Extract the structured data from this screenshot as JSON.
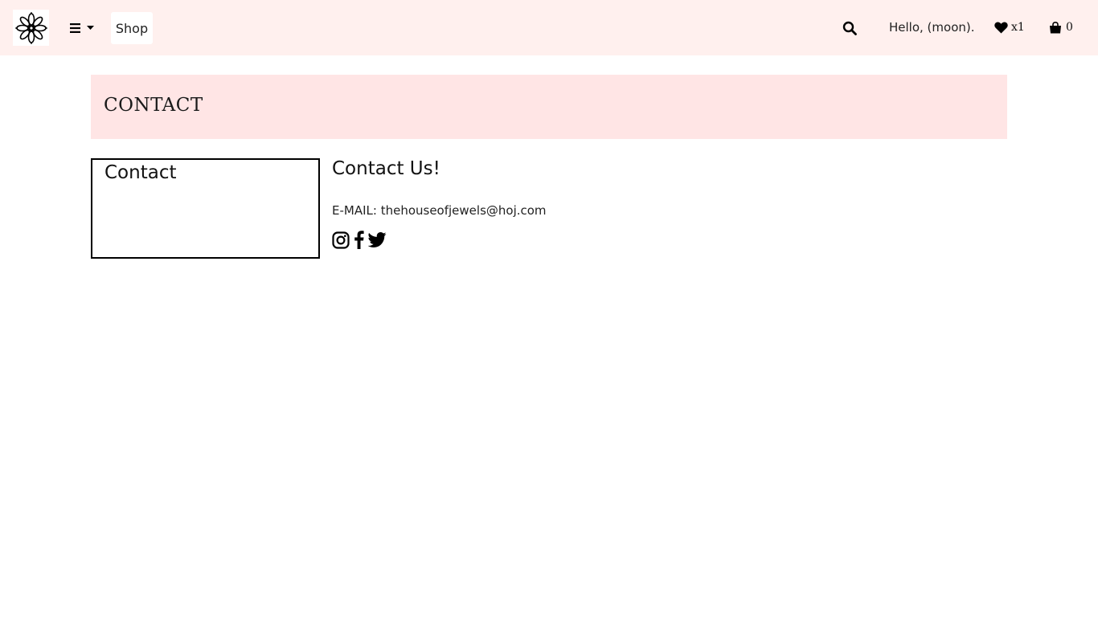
{
  "nav": {
    "logo_icon": "flower-logo-icon",
    "menu_icon": "hamburger-icon",
    "shop_label": "Shop",
    "greeting": "Hello, (moon).",
    "wishlist_count": "x1",
    "cart_count": "0"
  },
  "page": {
    "title": "CONTACT"
  },
  "sidebar": {
    "title": "Contact"
  },
  "content": {
    "title": "Contact Us!",
    "email_line": "E-MAIL: thehouseofjewels@hoj.com",
    "socials": [
      "instagram-icon",
      "facebook-icon",
      "twitter-icon"
    ]
  },
  "colors": {
    "navbar_bg": "#fff0ee",
    "header_bg": "#ffe5e5",
    "text": "#111111"
  }
}
